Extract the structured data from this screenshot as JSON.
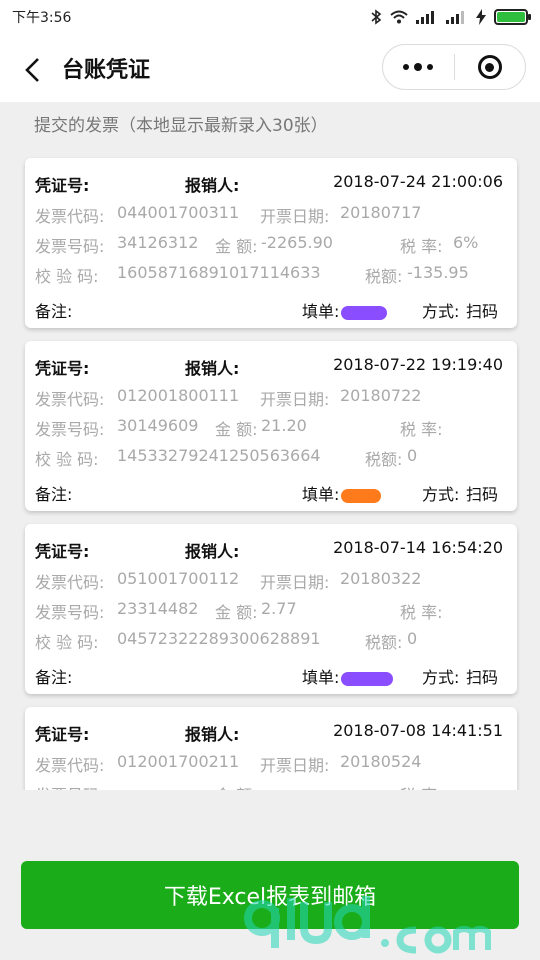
{
  "status": {
    "time": "下午3:56"
  },
  "nav": {
    "title": "台账凭证"
  },
  "section": {
    "title": "提交的发票（本地显示最新录入30张）"
  },
  "labels": {
    "voucher": "凭证号:",
    "reimburser": "报销人:",
    "invoice_code": "发票代码:",
    "invoice_date": "开票日期:",
    "invoice_number": "发票号码:",
    "amount": "金 额:",
    "tax_rate": "税 率:",
    "check_code": "校 验 码:",
    "tax_amount": "税额:",
    "remark": "备注:",
    "filler": "填单:",
    "method": "方式:"
  },
  "cards": [
    {
      "datetime": "2018-07-24 21:00:06",
      "invoice_code": "044001700311",
      "invoice_date": "20180717",
      "invoice_number": "34126312",
      "amount": "-2265.90",
      "tax_rate": "6%",
      "check_code": "16058716891017114633",
      "tax_amount": "-135.95",
      "method": "扫码",
      "redaction_color": "#8a4dff"
    },
    {
      "datetime": "2018-07-22 19:19:40",
      "invoice_code": "012001800111",
      "invoice_date": "20180722",
      "invoice_number": "30149609",
      "amount": "21.20",
      "tax_rate": "",
      "check_code": "14533279241250563664",
      "tax_amount": "0",
      "method": "扫码",
      "redaction_color": "#ff7a1a"
    },
    {
      "datetime": "2018-07-14 16:54:20",
      "invoice_code": "051001700112",
      "invoice_date": "20180322",
      "invoice_number": "23314482",
      "amount": "2.77",
      "tax_rate": "",
      "check_code": "04572322289300628891",
      "tax_amount": "0",
      "method": "扫码",
      "redaction_color": "#8a4dff"
    },
    {
      "datetime": "2018-07-08 14:41:51",
      "invoice_code": "012001700211",
      "invoice_date": "20180524"
    }
  ],
  "download_button": {
    "label": "下载Excel报表到邮箱"
  },
  "colors": {
    "primary": "#1aad19",
    "text_gray": "#a9a9a9"
  }
}
